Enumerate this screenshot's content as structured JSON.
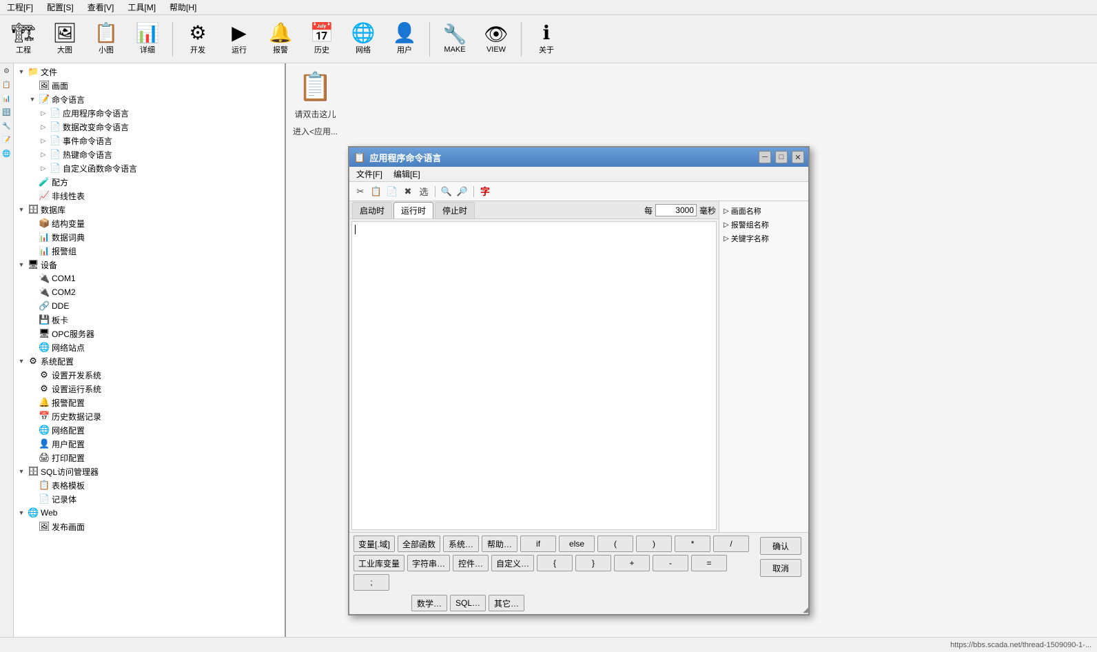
{
  "menubar": {
    "items": [
      "工程[F]",
      "配置[S]",
      "查看[V]",
      "工具[M]",
      "帮助[H]"
    ]
  },
  "toolbar": {
    "buttons": [
      {
        "label": "工程",
        "icon": "🏗"
      },
      {
        "label": "大图",
        "icon": "🖼"
      },
      {
        "label": "小图",
        "icon": "📋"
      },
      {
        "label": "详细",
        "icon": "📊"
      },
      {
        "label": "开发",
        "icon": "⚙"
      },
      {
        "label": "运行",
        "icon": "▶"
      },
      {
        "label": "报警",
        "icon": "🔔"
      },
      {
        "label": "历史",
        "icon": "📅"
      },
      {
        "label": "网络",
        "icon": "🌐"
      },
      {
        "label": "用户",
        "icon": "👤"
      },
      {
        "label": "MAKE",
        "icon": "🔧"
      },
      {
        "label": "VIEW",
        "icon": "👁"
      },
      {
        "label": "关于",
        "icon": "ℹ"
      }
    ]
  },
  "tree": {
    "nodes": [
      {
        "id": "files",
        "label": "文件",
        "indent": 0,
        "expanded": true,
        "icon": "📁",
        "expand": "▼"
      },
      {
        "id": "screen",
        "label": "画面",
        "indent": 1,
        "expanded": false,
        "icon": "🖼",
        "expand": ""
      },
      {
        "id": "commands",
        "label": "命令语言",
        "indent": 1,
        "expanded": true,
        "icon": "📝",
        "expand": "▼"
      },
      {
        "id": "app-cmd",
        "label": "应用程序命令语言",
        "indent": 2,
        "expanded": false,
        "icon": "📄",
        "expand": "▷"
      },
      {
        "id": "data-cmd",
        "label": "数据改变命令语言",
        "indent": 2,
        "expanded": false,
        "icon": "📄",
        "expand": "▷"
      },
      {
        "id": "event-cmd",
        "label": "事件命令语言",
        "indent": 2,
        "expanded": false,
        "icon": "📄",
        "expand": "▷"
      },
      {
        "id": "hotkey-cmd",
        "label": "热键命令语言",
        "indent": 2,
        "expanded": false,
        "icon": "📄",
        "expand": "▷"
      },
      {
        "id": "custom-cmd",
        "label": "自定义函数命令语言",
        "indent": 2,
        "expanded": false,
        "icon": "📄",
        "expand": "▷"
      },
      {
        "id": "formula",
        "label": "配方",
        "indent": 1,
        "expanded": false,
        "icon": "🧪",
        "expand": ""
      },
      {
        "id": "nonlinear",
        "label": "非线性表",
        "indent": 1,
        "expanded": false,
        "icon": "📈",
        "expand": ""
      },
      {
        "id": "database",
        "label": "数据库",
        "indent": 0,
        "expanded": true,
        "icon": "🗄",
        "expand": "▼"
      },
      {
        "id": "struct-var",
        "label": "结构变量",
        "indent": 1,
        "expanded": false,
        "icon": "📦",
        "expand": ""
      },
      {
        "id": "data-dict",
        "label": "数据词典",
        "indent": 1,
        "expanded": false,
        "icon": "📊",
        "expand": ""
      },
      {
        "id": "report-grp",
        "label": "报警组",
        "indent": 1,
        "expanded": false,
        "icon": "📊",
        "expand": ""
      },
      {
        "id": "devices",
        "label": "设备",
        "indent": 0,
        "expanded": true,
        "icon": "🖥",
        "expand": "▼"
      },
      {
        "id": "com1",
        "label": "COM1",
        "indent": 1,
        "expanded": false,
        "icon": "🔌",
        "expand": ""
      },
      {
        "id": "com2",
        "label": "COM2",
        "indent": 1,
        "expanded": false,
        "icon": "🔌",
        "expand": ""
      },
      {
        "id": "dde",
        "label": "DDE",
        "indent": 1,
        "expanded": false,
        "icon": "🔗",
        "expand": ""
      },
      {
        "id": "board",
        "label": "板卡",
        "indent": 1,
        "expanded": false,
        "icon": "💾",
        "expand": ""
      },
      {
        "id": "opc-server",
        "label": "OPC服务器",
        "indent": 1,
        "expanded": false,
        "icon": "🖥",
        "expand": ""
      },
      {
        "id": "net-station",
        "label": "网络站点",
        "indent": 1,
        "expanded": false,
        "icon": "🌐",
        "expand": ""
      },
      {
        "id": "sys-config",
        "label": "系统配置",
        "indent": 0,
        "expanded": true,
        "icon": "⚙",
        "expand": "▼"
      },
      {
        "id": "dev-sys",
        "label": "设置开发系统",
        "indent": 1,
        "expanded": false,
        "icon": "⚙",
        "expand": ""
      },
      {
        "id": "run-sys",
        "label": "设置运行系统",
        "indent": 1,
        "expanded": false,
        "icon": "⚙",
        "expand": ""
      },
      {
        "id": "alarm-config",
        "label": "报警配置",
        "indent": 1,
        "expanded": false,
        "icon": "🔔",
        "expand": ""
      },
      {
        "id": "hist-data",
        "label": "历史数据记录",
        "indent": 1,
        "expanded": false,
        "icon": "📅",
        "expand": ""
      },
      {
        "id": "net-config",
        "label": "网络配置",
        "indent": 1,
        "expanded": false,
        "icon": "🌐",
        "expand": ""
      },
      {
        "id": "user-config",
        "label": "用户配置",
        "indent": 1,
        "expanded": false,
        "icon": "👤",
        "expand": ""
      },
      {
        "id": "print-config",
        "label": "打印配置",
        "indent": 1,
        "expanded": false,
        "icon": "🖨",
        "expand": ""
      },
      {
        "id": "sql-manager",
        "label": "SQL访问管理器",
        "indent": 0,
        "expanded": true,
        "icon": "🗄",
        "expand": "▼"
      },
      {
        "id": "table-tpl",
        "label": "表格模板",
        "indent": 1,
        "expanded": false,
        "icon": "📋",
        "expand": ""
      },
      {
        "id": "record-body",
        "label": "记录体",
        "indent": 1,
        "expanded": false,
        "icon": "📄",
        "expand": ""
      },
      {
        "id": "web",
        "label": "Web",
        "indent": 0,
        "expanded": true,
        "icon": "🌐",
        "expand": "▼"
      },
      {
        "id": "publish-screen",
        "label": "发布画面",
        "indent": 1,
        "expanded": false,
        "icon": "🖼",
        "expand": ""
      }
    ]
  },
  "hint": {
    "icon": "📋",
    "line1": "请双击这儿",
    "line2": "进入<应用..."
  },
  "dialog": {
    "title": "应用程序命令语言",
    "title_icon": "📋",
    "menus": [
      "文件[F]",
      "编辑[E]"
    ],
    "toolbar_icons": [
      "✂",
      "📋",
      "📄",
      "✖",
      "选",
      "🔍",
      "🔎",
      "字"
    ],
    "tabs": [
      {
        "label": "启动时",
        "active": false
      },
      {
        "label": "运行时",
        "active": true
      },
      {
        "label": "停止时",
        "active": false
      }
    ],
    "interval_label": "每",
    "interval_value": "3000",
    "interval_unit": "毫秒",
    "editor_content": "",
    "sidebar_items": [
      {
        "label": "画面名称",
        "expand": "▷"
      },
      {
        "label": "报警组名称",
        "expand": "▷"
      },
      {
        "label": "关键字名称",
        "expand": "▷"
      }
    ],
    "btn_row1": [
      {
        "label": "变量[.域]"
      },
      {
        "label": "全部函数"
      },
      {
        "label": "系统…"
      },
      {
        "label": "帮助…"
      },
      {
        "label": "if"
      },
      {
        "label": "else"
      },
      {
        "label": "("
      },
      {
        "label": ")"
      },
      {
        "label": "*"
      },
      {
        "label": "/"
      }
    ],
    "btn_row1_extra": [
      {
        "label": "确认",
        "type": "action"
      },
      {
        "label": "取消",
        "type": "action"
      }
    ],
    "btn_row2": [
      {
        "label": "工业库变量"
      },
      {
        "label": "字符串…"
      },
      {
        "label": "控件…"
      },
      {
        "label": "自定义…"
      },
      {
        "label": "{"
      },
      {
        "label": "}"
      },
      {
        "label": "+"
      },
      {
        "label": "-"
      },
      {
        "label": "="
      },
      {
        "label": ";"
      }
    ],
    "btn_row3_extra": [
      {
        "label": "数学…"
      },
      {
        "label": "SQL…"
      },
      {
        "label": "其它…"
      }
    ]
  },
  "statusbar": {
    "url": "https://bbs.scada.net/thread-1509090-1-..."
  }
}
